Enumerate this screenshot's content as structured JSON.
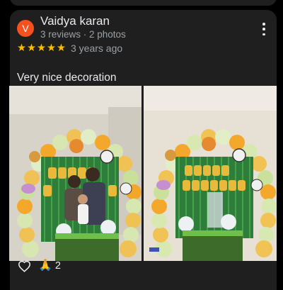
{
  "review": {
    "avatar_initial": "V",
    "avatar_color": "#f4511e",
    "name": "Vaidya karan",
    "meta": "3 reviews · 2 photos",
    "rating": 5,
    "rating_stars": "★★★★★",
    "star_color": "#fbbc04",
    "time_ago": "3 years ago",
    "text": "Very nice decoration",
    "photos_count": 2,
    "actions": {
      "like_icon": "heart-outline-icon",
      "thanks_icon": "folded-hands-icon",
      "thanks_glyph": "🙏",
      "thanks_count": "2"
    }
  }
}
